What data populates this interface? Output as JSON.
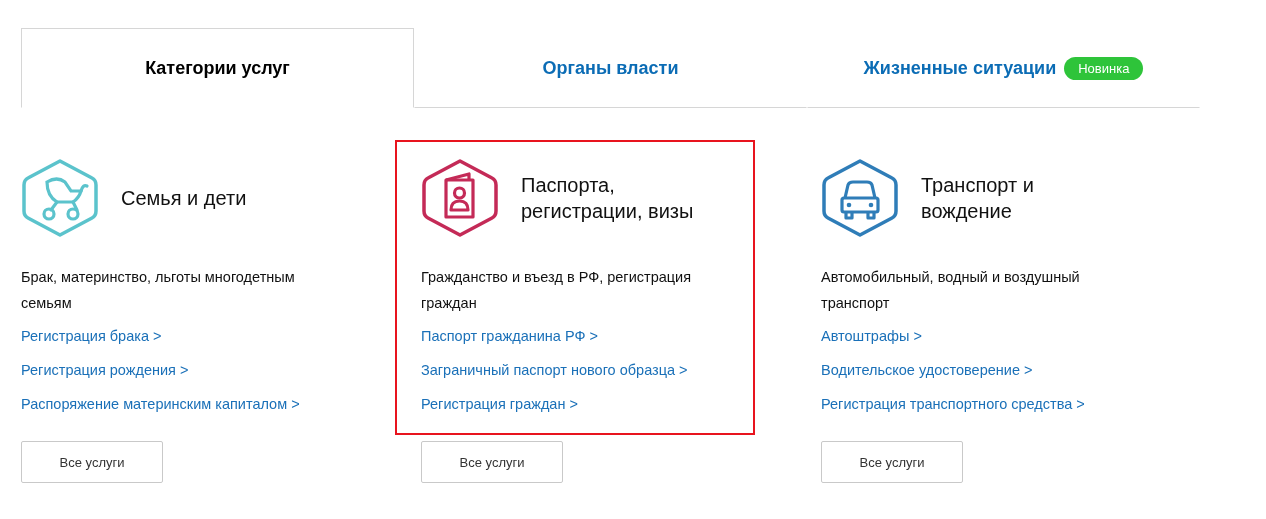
{
  "tabs": [
    {
      "label": "Категории услуг",
      "selected": true
    },
    {
      "label": "Органы власти",
      "selected": false
    },
    {
      "label": "Жизненные ситуации",
      "selected": false,
      "badge": "Новинка"
    }
  ],
  "categories": [
    {
      "kind": "stroller",
      "color": "#5bc3cc",
      "title": "Семья и дети",
      "description": "Брак, материнство, льготы многодетным семьям",
      "highlighted": false,
      "links": [
        "Регистрация брака >",
        "Регистрация рождения >",
        "Распоряжение материнским капиталом >"
      ],
      "button": "Все услуги"
    },
    {
      "kind": "passport",
      "color": "#c42a57",
      "title": "Паспорта, регистрации, визы",
      "description": "Гражданство и въезд в РФ, регистрация граждан",
      "highlighted": true,
      "links": [
        "Паспорт гражданина РФ >",
        "Заграничный паспорт нового образца >",
        "Регистрация граждан >"
      ],
      "button": "Все услуги"
    },
    {
      "kind": "car",
      "color": "#2f7db8",
      "title": "Транспорт и вождение",
      "description": "Автомобильный, водный и воздушный транспорт",
      "highlighted": false,
      "links": [
        "Автоштрафы >",
        "Водительское удостоверение >",
        "Регистрация транспортного средства >"
      ],
      "button": "Все услуги"
    }
  ]
}
